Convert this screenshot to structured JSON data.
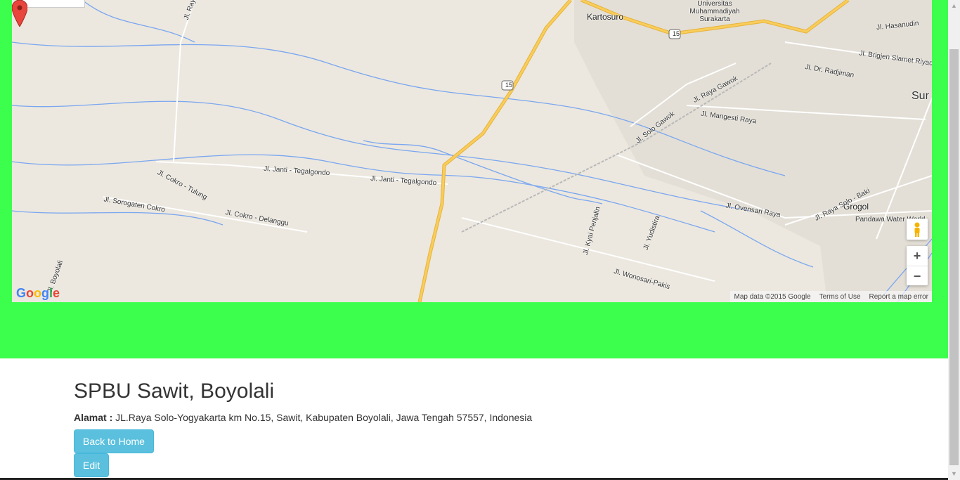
{
  "map": {
    "labels": {
      "kartosuro": "Kartosuro",
      "ums": "Universitas Muhammadiyah Surakarta",
      "hasanudin": "Jl. Hasanudin",
      "brigjen": "Jl. Brigjen Slamet Riyadi",
      "radjiman": "Jl. Dr. Radjiman",
      "raya_gawok": "Jl. Raya Gawok",
      "solo_gawok": "Jl. Solo Gawok",
      "mangesti": "Jl. Mangesti Raya",
      "sur": "Sur",
      "janti1": "Jl. Janti - Tegalgondo",
      "janti2": "Jl. Janti - Tegalgondo",
      "cokro_tulung": "Jl. Cokro - Tulung",
      "sorogaten": "Jl. Sorogaten Cokro",
      "cokro_delanggu": "Jl. Cokro - Delanggu",
      "ovensari": "Jl. Ovensari Raya",
      "grogol": "Grogol",
      "solo_baki": "Jl. Raya Solo - Baki",
      "pandawa": "Pandawa Water World",
      "kyai": "Jl. Kyai Penjalin",
      "yudistira": "Jl. Yudistira",
      "wonosari": "Jl. Wonosari-Pakis",
      "boyolali": "Jl. Boyolali",
      "jl_ray": "Jl. Ray",
      "route15": "15"
    },
    "footer": {
      "map_data": "Map data ©2015 Google",
      "terms": "Terms of Use",
      "report": "Report a map error"
    },
    "zoom_in": "+",
    "zoom_out": "−",
    "logo": "Google"
  },
  "place": {
    "title": "SPBU Sawit, Boyolali",
    "address_label": "Alamat :",
    "address_value": "JL.Raya Solo-Yogyakarta km No.15, Sawit, Kabupaten Boyolali, Jawa Tengah 57557, Indonesia"
  },
  "buttons": {
    "back": "Back to Home",
    "edit": "Edit"
  },
  "colors": {
    "band": "#3cff4d",
    "button": "#5bc0de",
    "highway": "#f8cd5b",
    "river": "#7aa6f0"
  }
}
